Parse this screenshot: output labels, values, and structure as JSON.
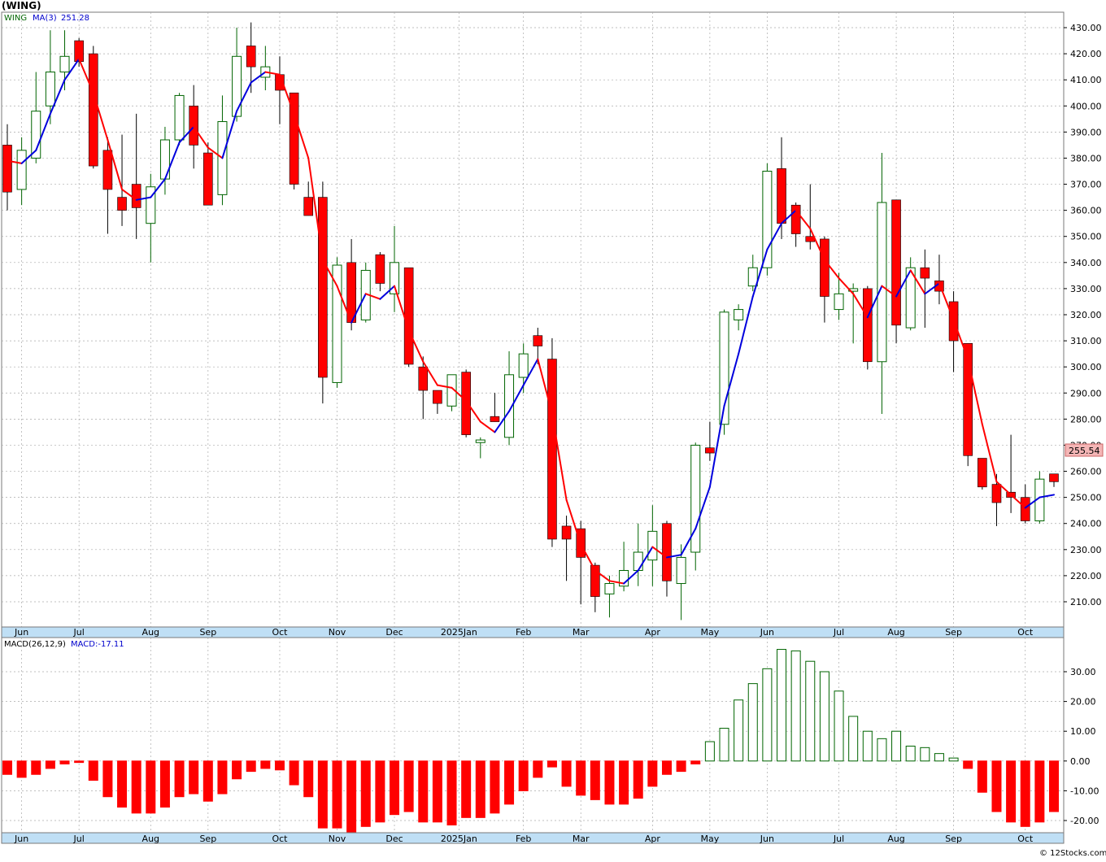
{
  "title": "(WING)",
  "price_panel": {
    "legend_symbol": "WING",
    "legend_ma": "MA(3)",
    "legend_ma_value": "251.28",
    "last_price_label": "255.54"
  },
  "macd_panel": {
    "legend_name": "MACD(26,12,9)",
    "legend_value": "MACD:-17.11"
  },
  "watermark": "© 12Stocks.com",
  "colors": {
    "up_candle_border": "#006400",
    "down_candle_fill": "#ff0000",
    "ma_up": "#0000dd",
    "ma_down": "#ff0000",
    "grid": "#aaaaaa",
    "axis_bar": "#bfdff5",
    "last_price_bg": "#f4b6b6"
  },
  "chart_data": [
    {
      "type": "candlestick",
      "ylim": [
        202,
        434
      ],
      "yticks": [
        210,
        220,
        230,
        240,
        250,
        260,
        270,
        280,
        290,
        300,
        310,
        320,
        330,
        340,
        350,
        360,
        370,
        380,
        390,
        400,
        410,
        420,
        430
      ],
      "ytick_labels": [
        "210.00",
        "220.00",
        "230.00",
        "240.00",
        "250.00",
        "260.00",
        "270.00",
        "280.00",
        "290.00",
        "300.00",
        "310.00",
        "320.00",
        "330.00",
        "340.00",
        "350.00",
        "360.00",
        "370.00",
        "380.00",
        "390.00",
        "400.00",
        "410.00",
        "420.00",
        "430.00"
      ],
      "x_months": [
        {
          "label": "Jun",
          "week": 1
        },
        {
          "label": "Jul",
          "week": 5
        },
        {
          "label": "Aug",
          "week": 10
        },
        {
          "label": "Sep",
          "week": 14
        },
        {
          "label": "Oct",
          "week": 19
        },
        {
          "label": "Nov",
          "week": 23
        },
        {
          "label": "Dec",
          "week": 27
        },
        {
          "label": "2025Jan",
          "week": 31.5
        },
        {
          "label": "Feb",
          "week": 36
        },
        {
          "label": "Mar",
          "week": 40
        },
        {
          "label": "Apr",
          "week": 45
        },
        {
          "label": "May",
          "week": 49
        },
        {
          "label": "Jun",
          "week": 53
        },
        {
          "label": "Jul",
          "week": 58
        },
        {
          "label": "Aug",
          "week": 62
        },
        {
          "label": "Sep",
          "week": 66
        },
        {
          "label": "Oct",
          "week": 71
        }
      ],
      "candles": [
        {
          "o": 385,
          "h": 393,
          "l": 360,
          "c": 367
        },
        {
          "o": 368,
          "h": 388,
          "l": 362,
          "c": 383
        },
        {
          "o": 380,
          "h": 413,
          "l": 378,
          "c": 398
        },
        {
          "o": 400,
          "h": 429,
          "l": 393,
          "c": 413
        },
        {
          "o": 413,
          "h": 429,
          "l": 406,
          "c": 419
        },
        {
          "o": 425,
          "h": 426,
          "l": 415,
          "c": 417
        },
        {
          "o": 420,
          "h": 423,
          "l": 376,
          "c": 377
        },
        {
          "o": 383,
          "h": 388,
          "l": 351,
          "c": 368
        },
        {
          "o": 365,
          "h": 389,
          "l": 354,
          "c": 360
        },
        {
          "o": 370,
          "h": 397,
          "l": 349,
          "c": 361
        },
        {
          "o": 355,
          "h": 374,
          "l": 340,
          "c": 369
        },
        {
          "o": 372,
          "h": 392,
          "l": 366,
          "c": 387
        },
        {
          "o": 387,
          "h": 405,
          "l": 385,
          "c": 404
        },
        {
          "o": 400,
          "h": 408,
          "l": 376,
          "c": 385
        },
        {
          "o": 382,
          "h": 386,
          "l": 362,
          "c": 362
        },
        {
          "o": 366,
          "h": 404,
          "l": 362,
          "c": 394
        },
        {
          "o": 396,
          "h": 430,
          "l": 394,
          "c": 419
        },
        {
          "o": 423,
          "h": 432,
          "l": 405,
          "c": 415
        },
        {
          "o": 411,
          "h": 423,
          "l": 406,
          "c": 415
        },
        {
          "o": 412,
          "h": 419,
          "l": 393,
          "c": 406
        },
        {
          "o": 405,
          "h": 405,
          "l": 368,
          "c": 370
        },
        {
          "o": 365,
          "h": 371,
          "l": 358,
          "c": 358
        },
        {
          "o": 365,
          "h": 371,
          "l": 286,
          "c": 296
        },
        {
          "o": 294,
          "h": 342,
          "l": 292,
          "c": 339
        },
        {
          "o": 340,
          "h": 349,
          "l": 314,
          "c": 317
        },
        {
          "o": 318,
          "h": 340,
          "l": 317,
          "c": 337
        },
        {
          "o": 343,
          "h": 344,
          "l": 329,
          "c": 332
        },
        {
          "o": 328,
          "h": 354,
          "l": 321,
          "c": 340
        },
        {
          "o": 338,
          "h": 338,
          "l": 300,
          "c": 301
        },
        {
          "o": 300,
          "h": 304,
          "l": 280,
          "c": 291
        },
        {
          "o": 291,
          "h": 291,
          "l": 282,
          "c": 286
        },
        {
          "o": 285,
          "h": 297,
          "l": 283,
          "c": 297
        },
        {
          "o": 298,
          "h": 299,
          "l": 273,
          "c": 274
        },
        {
          "o": 271,
          "h": 273,
          "l": 265,
          "c": 272
        },
        {
          "o": 281,
          "h": 290,
          "l": 279,
          "c": 279
        },
        {
          "o": 273,
          "h": 306,
          "l": 270,
          "c": 297
        },
        {
          "o": 296,
          "h": 309,
          "l": 290,
          "c": 305
        },
        {
          "o": 312,
          "h": 315,
          "l": 301,
          "c": 308
        },
        {
          "o": 303,
          "h": 311,
          "l": 231,
          "c": 234
        },
        {
          "o": 239,
          "h": 243,
          "l": 218,
          "c": 234
        },
        {
          "o": 238,
          "h": 241,
          "l": 209,
          "c": 227
        },
        {
          "o": 224,
          "h": 225,
          "l": 206,
          "c": 212
        },
        {
          "o": 213,
          "h": 220,
          "l": 204,
          "c": 217
        },
        {
          "o": 216,
          "h": 233,
          "l": 214,
          "c": 222
        },
        {
          "o": 222,
          "h": 240,
          "l": 216,
          "c": 229
        },
        {
          "o": 226,
          "h": 247,
          "l": 216,
          "c": 237
        },
        {
          "o": 240,
          "h": 241,
          "l": 212,
          "c": 218
        },
        {
          "o": 217,
          "h": 232,
          "l": 203,
          "c": 227
        },
        {
          "o": 229,
          "h": 271,
          "l": 222,
          "c": 270
        },
        {
          "o": 269,
          "h": 279,
          "l": 264,
          "c": 267
        },
        {
          "o": 278,
          "h": 322,
          "l": 274,
          "c": 321
        },
        {
          "o": 318,
          "h": 324,
          "l": 314,
          "c": 322
        },
        {
          "o": 331,
          "h": 343,
          "l": 329,
          "c": 338
        },
        {
          "o": 338,
          "h": 378,
          "l": 335,
          "c": 375
        },
        {
          "o": 376,
          "h": 388,
          "l": 349,
          "c": 355
        },
        {
          "o": 362,
          "h": 363,
          "l": 346,
          "c": 351
        },
        {
          "o": 350,
          "h": 370,
          "l": 345,
          "c": 348
        },
        {
          "o": 349,
          "h": 350,
          "l": 317,
          "c": 327
        },
        {
          "o": 322,
          "h": 336,
          "l": 318,
          "c": 328
        },
        {
          "o": 329,
          "h": 332,
          "l": 309,
          "c": 330
        },
        {
          "o": 330,
          "h": 331,
          "l": 299,
          "c": 302
        },
        {
          "o": 302,
          "h": 382,
          "l": 282,
          "c": 363
        },
        {
          "o": 364,
          "h": 364,
          "l": 309,
          "c": 316
        },
        {
          "o": 315,
          "h": 342,
          "l": 314,
          "c": 338
        },
        {
          "o": 338,
          "h": 345,
          "l": 315,
          "c": 334
        },
        {
          "o": 333,
          "h": 343,
          "l": 324,
          "c": 329
        },
        {
          "o": 325,
          "h": 329,
          "l": 298,
          "c": 310
        },
        {
          "o": 309,
          "h": 309,
          "l": 262,
          "c": 266
        },
        {
          "o": 265,
          "h": 265,
          "l": 253,
          "c": 254
        },
        {
          "o": 255,
          "h": 259,
          "l": 239,
          "c": 248
        },
        {
          "o": 252,
          "h": 274,
          "l": 244,
          "c": 250
        },
        {
          "o": 250,
          "h": 255,
          "l": 240,
          "c": 241
        },
        {
          "o": 241,
          "h": 260,
          "l": 240,
          "c": 257
        },
        {
          "o": 259,
          "h": 259,
          "l": 254,
          "c": 256
        }
      ],
      "ma": [
        379,
        378,
        383,
        397,
        410,
        418,
        405,
        387,
        368,
        364,
        365,
        372,
        386,
        392,
        384,
        380,
        398,
        409,
        413,
        412,
        397,
        380,
        341,
        331,
        317,
        328,
        326,
        331,
        314,
        302,
        293,
        292,
        287,
        279,
        275,
        283,
        293,
        303,
        282,
        249,
        232,
        222,
        218,
        217,
        222,
        231,
        227,
        228,
        238,
        254,
        285,
        305,
        327,
        345,
        355,
        360,
        353,
        341,
        334,
        328,
        319,
        331,
        327,
        337,
        328,
        332,
        318,
        303,
        278,
        256,
        251,
        246,
        250,
        251
      ],
      "series": [
        {
          "name": "MA(3)"
        }
      ]
    },
    {
      "type": "bar",
      "title": "MACD(26,12,9)",
      "ylim": [
        -24.5,
        39
      ],
      "yticks": [
        -20,
        -10,
        0,
        10,
        20,
        30
      ],
      "ytick_labels": [
        "-20.00",
        "-10.00",
        "0.00",
        "10.00",
        "20.00",
        "30.00"
      ],
      "values": [
        -4.5,
        -5.5,
        -4.5,
        -2.5,
        -1,
        -0.5,
        -6.5,
        -12,
        -15.5,
        -17.5,
        -17.5,
        -15.5,
        -12,
        -11,
        -13.5,
        -11,
        -6,
        -3.5,
        -2.5,
        -3,
        -8,
        -12,
        -22.5,
        -22.5,
        -24.5,
        -22,
        -20.5,
        -18,
        -17,
        -20.5,
        -20.5,
        -21.5,
        -19,
        -19,
        -17.5,
        -14.5,
        -10,
        -5.5,
        -2,
        -8.5,
        -11.5,
        -13,
        -14.5,
        -14.5,
        -12.5,
        -8.5,
        -4.5,
        -3.5,
        -1,
        6.5,
        11,
        20.5,
        26,
        31,
        37.5,
        37,
        33.5,
        30,
        23.5,
        15,
        10,
        7.5,
        10,
        5,
        4.5,
        2.5,
        1,
        -2.5,
        -10.5,
        -17,
        -20.5,
        -22,
        -20.5,
        -17
      ]
    }
  ]
}
